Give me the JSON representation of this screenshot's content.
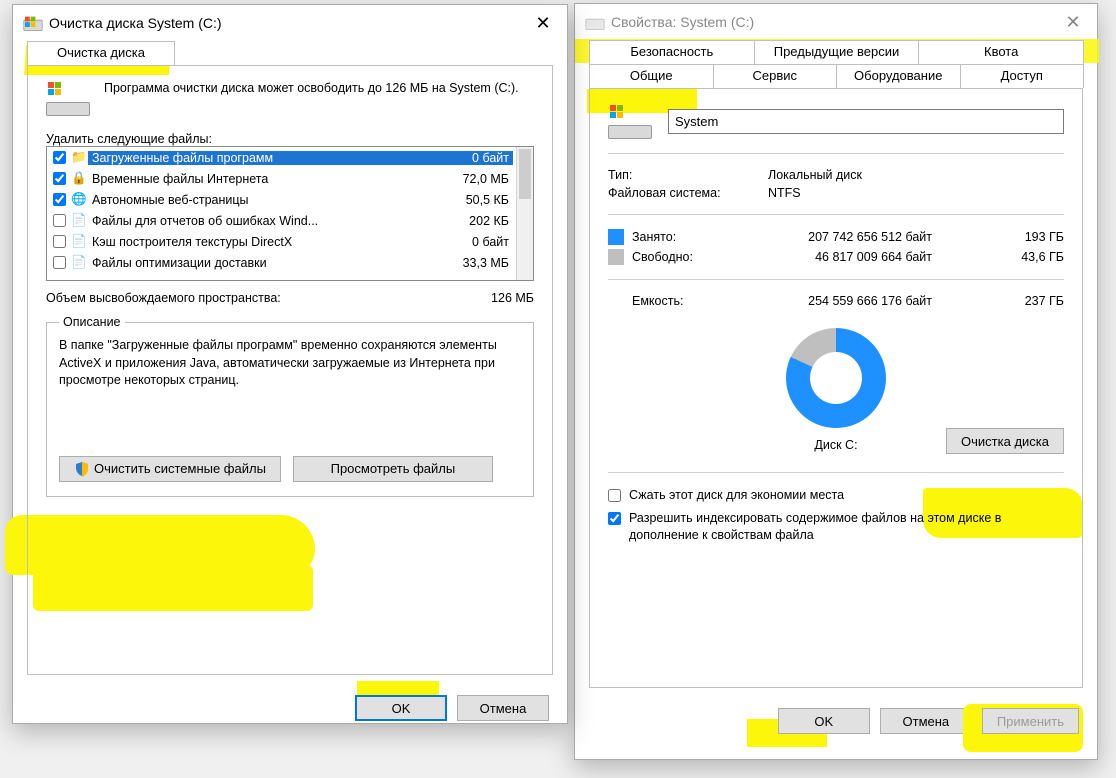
{
  "cleanup": {
    "title": "Очистка диска System (C:)",
    "tab": "Очистка диска",
    "intro": "Программа очистки диска может освободить до 126 МБ на System (C:).",
    "list_header": "Удалить следующие файлы:",
    "items": [
      {
        "checked": true,
        "icon": "folder",
        "name": "Загруженные файлы программ",
        "size": "0 байт",
        "selected": true
      },
      {
        "checked": true,
        "icon": "lock",
        "name": "Временные файлы Интернета",
        "size": "72,0 МБ"
      },
      {
        "checked": true,
        "icon": "globe",
        "name": "Автономные веб-страницы",
        "size": "50,5 КБ"
      },
      {
        "checked": false,
        "icon": "file",
        "name": "Файлы для отчетов об ошибках Wind...",
        "size": "202 КБ"
      },
      {
        "checked": false,
        "icon": "file",
        "name": "Кэш построителя текстуры DirectX",
        "size": "0 байт"
      },
      {
        "checked": false,
        "icon": "file",
        "name": "Файлы оптимизации доставки",
        "size": "33,3 МБ"
      }
    ],
    "total_label": "Объем высвобождаемого пространства:",
    "total_value": "126 МБ",
    "desc_legend": "Описание",
    "desc_text": "В папке \"Загруженные файлы программ\" временно сохраняются элементы ActiveX и приложения Java, автоматически загружаемые из Интернета при просмотре некоторых страниц.",
    "btn_system": "Очистить системные файлы",
    "btn_view": "Просмотреть файлы",
    "btn_ok": "OK",
    "btn_cancel": "Отмена"
  },
  "props": {
    "title": "Свойства: System (C:)",
    "tabs_row1": [
      "Безопасность",
      "Предыдущие версии",
      "Квота"
    ],
    "tabs_row2": [
      "Общие",
      "Сервис",
      "Оборудование",
      "Доступ"
    ],
    "volume_name": "System",
    "type_label": "Тип:",
    "type_value": "Локальный диск",
    "fs_label": "Файловая система:",
    "fs_value": "NTFS",
    "used_label": "Занято:",
    "used_bytes": "207 742 656 512 байт",
    "used_h": "193 ГБ",
    "free_label": "Свободно:",
    "free_bytes": "46 817 009 664 байт",
    "free_h": "43,6 ГБ",
    "cap_label": "Емкость:",
    "cap_bytes": "254 559 666 176 байт",
    "cap_h": "237 ГБ",
    "disk_label": "Диск C:",
    "btn_cleanup": "Очистка диска",
    "chk_compress": "Сжать этот диск для экономии места",
    "chk_index": "Разрешить индексировать содержимое файлов на этом диске в дополнение к свойствам файла",
    "btn_ok": "OK",
    "btn_cancel": "Отмена",
    "btn_apply": "Применить"
  },
  "chart_data": {
    "type": "pie",
    "title": "Диск C:",
    "series": [
      {
        "name": "Занято",
        "value": 207742656512,
        "human": "193 ГБ",
        "color": "#1e90ff"
      },
      {
        "name": "Свободно",
        "value": 46817009664,
        "human": "43,6 ГБ",
        "color": "#bfbfbf"
      }
    ],
    "total": {
      "label": "Емкость",
      "value": 254559666176,
      "human": "237 ГБ"
    }
  }
}
